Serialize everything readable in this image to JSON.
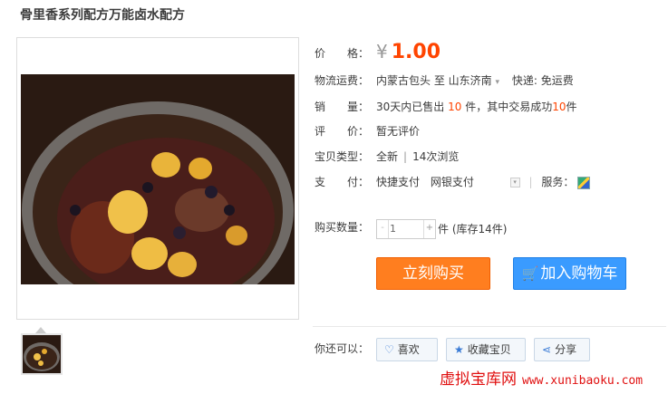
{
  "title": "骨里香系列配方万能卤水配方",
  "price": {
    "label": "价　　格：",
    "symbol": "¥",
    "value": "1.00"
  },
  "shipping": {
    "label": "物流运费：",
    "from": "内蒙古包头",
    "to": "至  山东济南",
    "arrow": "▾",
    "express": "快递: 免运费"
  },
  "sales": {
    "label": "销　　量：",
    "prefix": "30天内已售出",
    "sold": "10",
    "mid": "件，其中交易成功",
    "success": "10",
    "suffix": "件"
  },
  "review": {
    "label": "评　　价：",
    "value": "暂无评价"
  },
  "type": {
    "label": "宝贝类型：",
    "value": "全新",
    "views": "14次浏览"
  },
  "payment": {
    "label": "支　　付：",
    "method1": "快捷支付",
    "method2": "网银支付",
    "service_label": "服务："
  },
  "quantity": {
    "label": "购买数量：",
    "value": "1",
    "minus": "-",
    "plus": "+",
    "stock": "件 (库存14件)"
  },
  "buttons": {
    "buy": "立刻购买",
    "cart": "加入购物车"
  },
  "also": {
    "label": "你还可以：",
    "like": "喜欢",
    "favorite": "收藏宝贝",
    "share": "分享"
  },
  "watermark": {
    "cn": "虚拟宝库网",
    "url": "www.xunibaoku.com"
  },
  "icons": [
    "heart-icon",
    "star-icon",
    "share-icon",
    "cart-icon",
    "service-icon",
    "dropdown-icon"
  ]
}
